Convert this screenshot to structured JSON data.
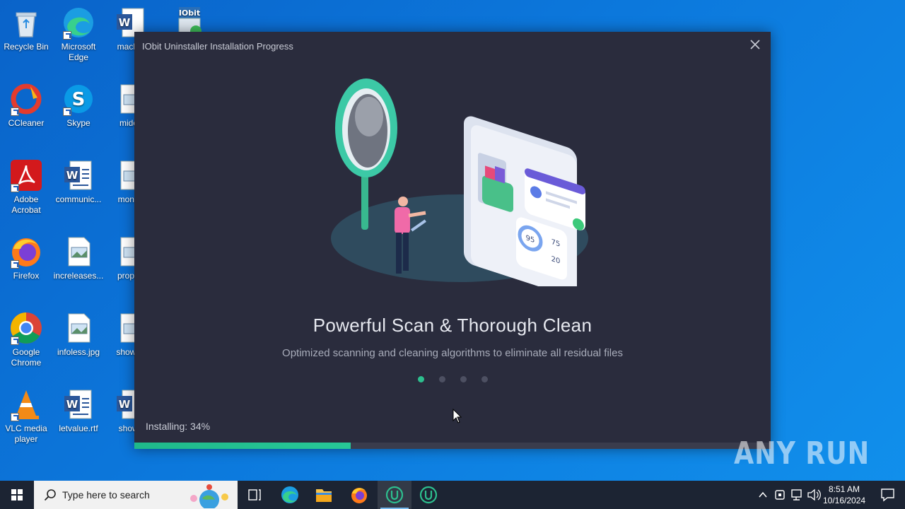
{
  "desktop": {
    "icons": [
      {
        "label": "Recycle Bin"
      },
      {
        "label": "Microsoft Edge"
      },
      {
        "label": "machin"
      },
      {
        "label": "CCleaner"
      },
      {
        "label": "Skype"
      },
      {
        "label": "midoc"
      },
      {
        "label": "Adobe Acrobat"
      },
      {
        "label": "communic..."
      },
      {
        "label": "monda"
      },
      {
        "label": "Firefox"
      },
      {
        "label": "increleases..."
      },
      {
        "label": "propert"
      },
      {
        "label": "Google Chrome"
      },
      {
        "label": "infoless.jpg"
      },
      {
        "label": "shownb"
      },
      {
        "label": "VLC media player"
      },
      {
        "label": "letvalue.rtf"
      },
      {
        "label": "shown"
      }
    ],
    "iobit_badge": "IObit"
  },
  "installer": {
    "title": "IObit Uninstaller Installation Progress",
    "close_icon": "close-icon",
    "headline": "Powerful Scan & Thorough Clean",
    "subline": "Optimized scanning and cleaning algorithms to eliminate all residual files",
    "slides": {
      "count": 4,
      "active": 0
    },
    "progress_label": "Installing: 34%",
    "progress_percent": 34,
    "illustration": {
      "gauge_values": [
        "95",
        "75",
        "20"
      ]
    },
    "colors": {
      "background": "#2a2c3d",
      "accent": "#2dbf8e"
    }
  },
  "watermark": "ANY RUN",
  "taskbar": {
    "search_placeholder": "Type here to search",
    "clock_time": "8:51 AM",
    "clock_date": "10/16/2024"
  }
}
